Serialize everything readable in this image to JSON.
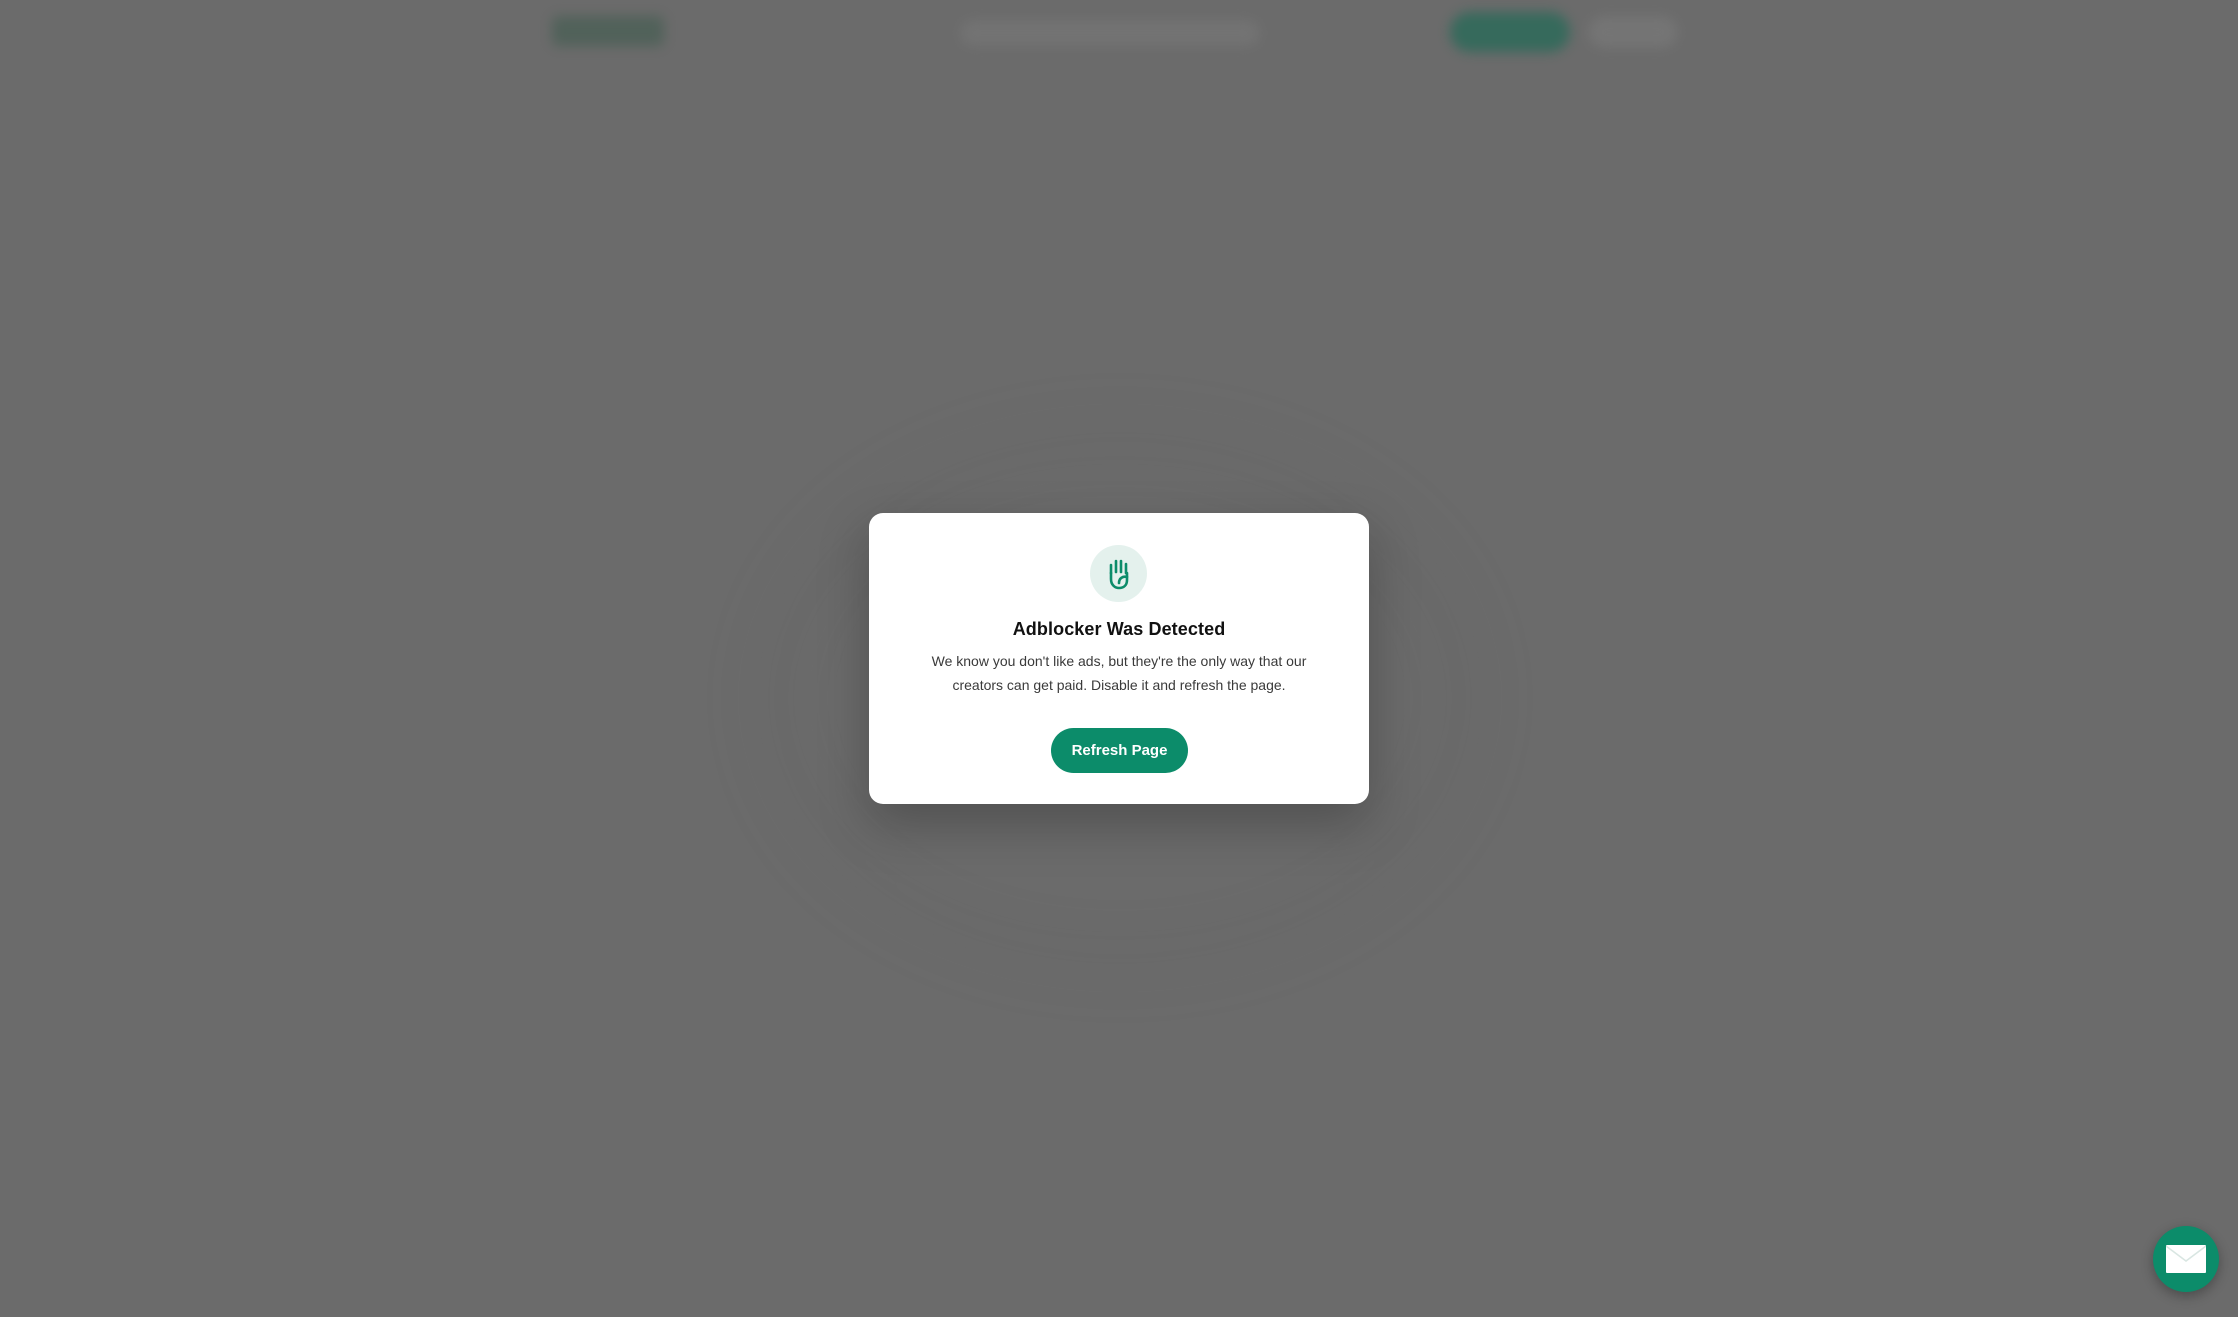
{
  "modal": {
    "title": "Adblocker Was Detected",
    "message": "We know you don't like ads, but they're the only way that our creators can get paid. Disable it and refresh the page.",
    "button_label": "Refresh Page",
    "icon": "hand-stop-icon"
  },
  "fab": {
    "icon": "mail-icon"
  },
  "colors": {
    "accent": "#0c8c6a",
    "icon_bg": "#e4f1ed",
    "overlay": "#6b6b6b"
  }
}
